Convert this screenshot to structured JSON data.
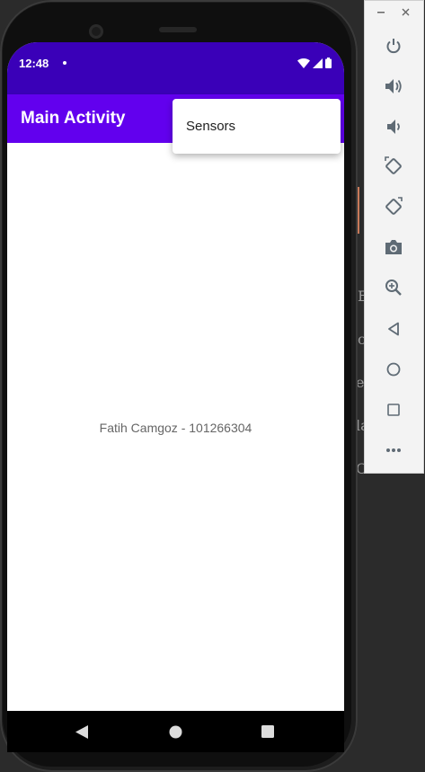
{
  "status_bar": {
    "time": "12:48"
  },
  "app_bar": {
    "title": "Main Activity"
  },
  "overflow_menu": {
    "items": [
      {
        "label": "Sensors"
      }
    ]
  },
  "main": {
    "text": "Fatih Camgoz - 101266304"
  },
  "nav_bar": {
    "buttons": [
      "back",
      "home",
      "recents"
    ]
  },
  "emulator_toolbar": {
    "window_controls": [
      "minimize",
      "close"
    ],
    "buttons": [
      "power",
      "volume-up",
      "volume-down",
      "rotate-left",
      "rotate-right",
      "screenshot",
      "zoom",
      "back",
      "home",
      "overview",
      "more"
    ]
  },
  "colors": {
    "status_bar": "#3a00b8",
    "app_bar": "#6200ee",
    "text_secondary": "#666666",
    "toolbar_icon": "#5f6b75"
  }
}
